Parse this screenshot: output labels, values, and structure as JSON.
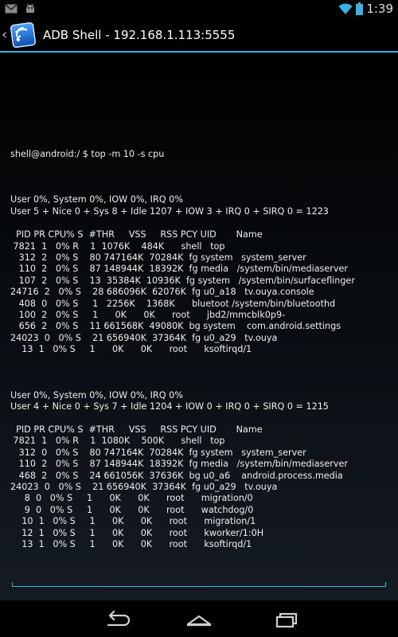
{
  "status_bar": {
    "time": "1:39",
    "icons": [
      "gmail-icon",
      "android-debug-icon",
      "wifi-icon",
      "battery-icon"
    ]
  },
  "action_bar": {
    "title": "ADB Shell - 192.168.1.113:5555",
    "accent": "#33b5e5"
  },
  "terminal": {
    "lines": [
      "shell@android:/ $ top -m 10 -s cpu",
      "",
      "",
      "",
      "User 0%, System 0%, IOW 0%, IRQ 0%",
      "User 5 + Nice 0 + Sys 8 + Idle 1207 + IOW 3 + IRQ 0 + SIRQ 0 = 1223",
      "",
      "  PID PR CPU% S  #THR     VSS     RSS PCY UID       Name",
      " 7821  1   0% R    1  1076K    484K      shell   top",
      "   312  2   0% S    80 747164K  70284K  fg system   system_server",
      "   110  2   0% S    87 148944K  18392K  fg media   /system/bin/mediaserver",
      "   107  2   0% S    13  35384K  10936K  fg system   /system/bin/surfaceflinger",
      "24716  2   0% S    28 686096K  62076K  fg u0_a18   tv.ouya.console",
      "   408  0   0% S     1   2256K    1368K      bluetoot /system/bin/bluetoothd",
      "   100  2   0% S     1      0K      0K      root      jbd2/mmcblk0p9-",
      "   656  2   0% S    11 661568K  49080K  bg system    com.android.settings",
      "24023  0   0% S    21 656940K  37364K  fg u0_a29   tv.ouya",
      "    13  1   0% S     1      0K      0K      root      ksoftirqd/1",
      "",
      "",
      "",
      "User 0%, System 0%, IOW 0%, IRQ 0%",
      "User 4 + Nice 0 + Sys 7 + Idle 1204 + IOW 0 + IRQ 0 + SIRQ 0 = 1215",
      "",
      "  PID PR CPU% S  #THR     VSS     RSS PCY UID       Name",
      " 7821  1   0% R    1  1080K    500K      shell   top",
      "   312  0   0% S    80 747164K  70284K  fg system   system_server",
      "   110  2   0% S    87 148944K  18392K  fg media   /system/bin/mediaserver",
      "   468  2   0% S    24 661056K  37636K  bg u0_a6    android.process.media",
      "24023  0   0% S    21 656940K  37364K  fg u0_a29   tv.ouya",
      "     8  0   0% S     1      0K      0K      root      migration/0",
      "     9  0   0% S     1      0K      0K      root      watchdog/0",
      "    10  1   0% S     1      0K      0K      root      migration/1",
      "    12  1   0% S     1      0K      0K      root      kworker/1:0H",
      "    13  1   0% S     1      0K      0K      root      ksoftirqd/1"
    ],
    "input_value": ""
  },
  "nav_bar": {
    "buttons": [
      "back-icon",
      "home-icon",
      "recent-apps-icon"
    ]
  }
}
